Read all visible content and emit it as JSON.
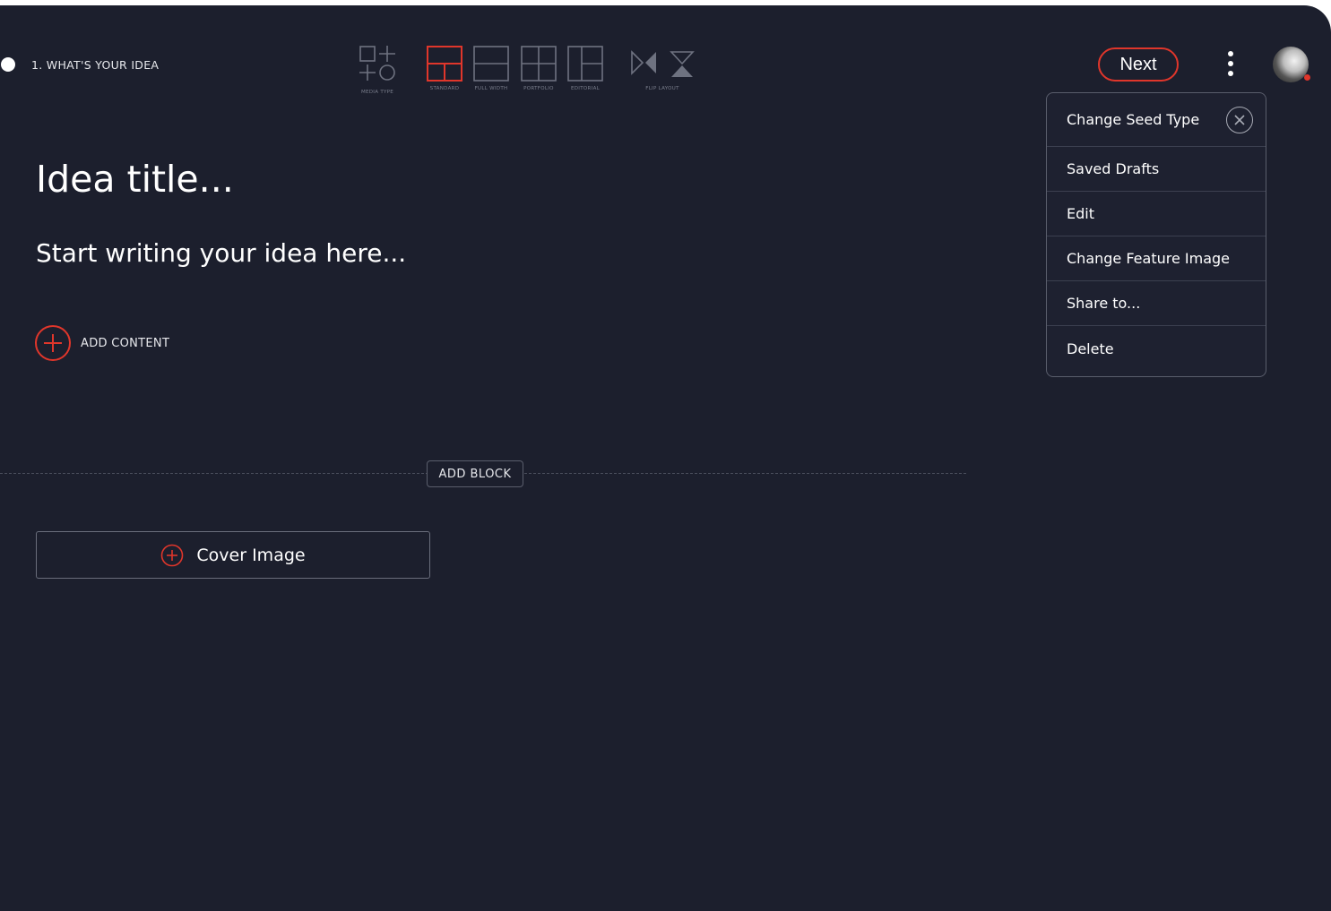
{
  "step": {
    "label": "1. WHAT'S YOUR IDEA"
  },
  "toolbar": {
    "media_type_caption": "MEDIA TYPE",
    "standard_caption": "STANDARD",
    "full_width_caption": "FULL WIDTH",
    "portfolio_caption": "PORTFOLIO",
    "editorial_caption": "EDITORIAL",
    "flip_layout_caption": "FLIP LAYOUT"
  },
  "header": {
    "next_label": "Next"
  },
  "menu": {
    "header_label": "Change Seed Type",
    "items": [
      {
        "label": "Saved Drafts"
      },
      {
        "label": "Edit"
      },
      {
        "label": "Change Feature Image"
      },
      {
        "label": "Share to..."
      },
      {
        "label": "Delete"
      }
    ]
  },
  "editor": {
    "title_placeholder": "Idea title...",
    "body_placeholder": "Start writing your idea here...",
    "add_content_label": "ADD CONTENT",
    "add_block_label": "ADD BLOCK",
    "cover_image_label": "Cover Image"
  },
  "colors": {
    "background": "#1c1f2d",
    "accent": "#e0362b",
    "text": "#ffffff"
  }
}
